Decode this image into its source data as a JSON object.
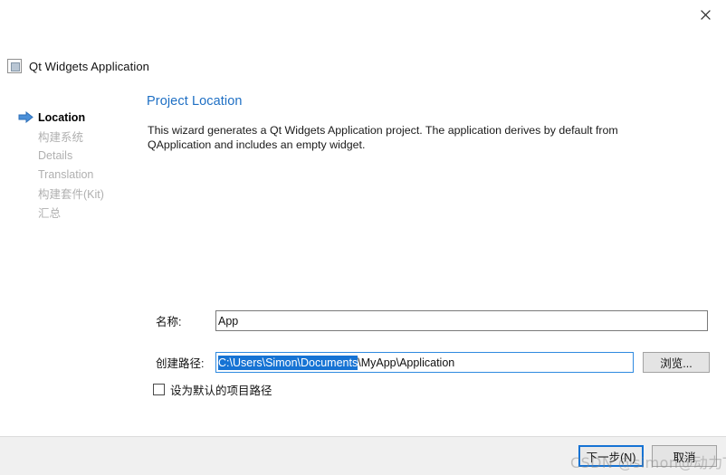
{
  "window": {
    "close_label": "✕",
    "caption": "Qt Widgets Application",
    "icon": "app-window-icon"
  },
  "sidebar": {
    "items": [
      {
        "label": "Location",
        "state": "active"
      },
      {
        "label": "构建系统",
        "state": "disabled"
      },
      {
        "label": "Details",
        "state": "disabled"
      },
      {
        "label": "Translation",
        "state": "disabled"
      },
      {
        "label": "构建套件(Kit)",
        "state": "disabled"
      },
      {
        "label": "汇总",
        "state": "disabled"
      }
    ],
    "arrow_icon": "arrow-right-icon",
    "active_color": "#000000",
    "disabled_color": "#b0b0b0",
    "arrow_color": "#3b84d8"
  },
  "panel": {
    "heading": "Project Location",
    "heading_color": "#1e6fc4",
    "description": "This wizard generates a Qt Widgets Application project. The application derives by default from QApplication and includes an empty widget."
  },
  "form": {
    "name": {
      "label": "名称:",
      "value": "App"
    },
    "path": {
      "label": "创建路径:",
      "value_selected": "C:\\Users\\Simon\\Documents",
      "value_rest": "\\MyApp\\Application",
      "selection_color": "#1673d4",
      "focus_border_color": "#2f8ae0"
    },
    "browse_button": "浏览...",
    "checkbox": {
      "label": "设为默认的项目路径",
      "checked": false
    }
  },
  "footer": {
    "next_button": "下一步(N)",
    "cancel_button": "取消",
    "default_button_border": "#1673d4"
  },
  "watermark": {
    "text": "CSDN @simon@动力TV"
  }
}
